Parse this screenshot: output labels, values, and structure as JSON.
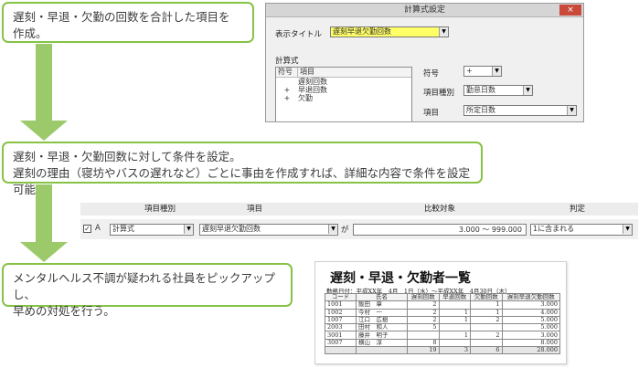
{
  "callouts": {
    "c1": {
      "line1": "遅刻・早退・欠勤の回数を合計した項目を",
      "line2": "作成。"
    },
    "c2": {
      "line1": "遅刻・早退・欠勤回数に対して条件を設定。",
      "line2": "遅刻の理由（寝坊やバスの遅れなど）ごとに事由を作成すれば、詳細な内容で条件を設定可能。"
    },
    "c3": {
      "line1": "メンタルヘルス不調が疑われる社員をピックアップし、",
      "line2": "早めの対処を行う。"
    }
  },
  "dialog": {
    "title": "計算式設定",
    "close": "×",
    "display_title_label": "表示タイトル",
    "display_title_value": "遅刻早退欠勤回数",
    "formula_label": "計算式",
    "list_headers": [
      "符号",
      "項目"
    ],
    "list_rows": [
      {
        "sign": "",
        "item": "遅刻回数"
      },
      {
        "sign": "+",
        "item": "早退回数"
      },
      {
        "sign": "+",
        "item": "欠勤"
      }
    ],
    "sign_label": "符号",
    "sign_value": "+",
    "item_type_label": "項目種別",
    "item_type_value": "勤怠日数",
    "item_label": "項目",
    "item_value": "所定日数"
  },
  "condition": {
    "headers": {
      "type": "項目種別",
      "item": "項目",
      "compare": "比較対象",
      "judge": "判定"
    },
    "checked": "✓",
    "letter": "A",
    "type_value": "計算式",
    "item_value": "遅刻早退欠勤回数",
    "ga": "が",
    "range_value": "3.000 ～ 999.000",
    "judge_value": "1に含まれる"
  },
  "report": {
    "title": "遅刻・早退・欠勤者一覧",
    "subtitle": "勤務日付：平成XX年　4月　1日（水）～平成XX年　4月30日（木）",
    "columns": [
      "コード",
      "氏名",
      "遅刻回数",
      "早退回数",
      "欠勤回数",
      "遅刻早退欠勤回数"
    ],
    "rows": [
      {
        "code": "1001",
        "name": "飯田　章",
        "late": "2",
        "early": "",
        "absent": "1",
        "total": "3.000"
      },
      {
        "code": "1002",
        "name": "今村　一",
        "late": "2",
        "early": "1",
        "absent": "1",
        "total": "4.000"
      },
      {
        "code": "1007",
        "name": "江口　広樹",
        "late": "2",
        "early": "1",
        "absent": "2",
        "total": "5.000"
      },
      {
        "code": "2003",
        "name": "田村　和人",
        "late": "5",
        "early": "",
        "absent": "",
        "total": "5.000"
      },
      {
        "code": "3001",
        "name": "藤井　明子",
        "late": "",
        "early": "1",
        "absent": "2",
        "total": "3.000"
      },
      {
        "code": "3007",
        "name": "横山　淳",
        "late": "8",
        "early": "",
        "absent": "",
        "total": "8.000"
      }
    ],
    "total_row": {
      "code": "",
      "name": "",
      "late": "19",
      "early": "3",
      "absent": "6",
      "total": "28.000"
    }
  }
}
